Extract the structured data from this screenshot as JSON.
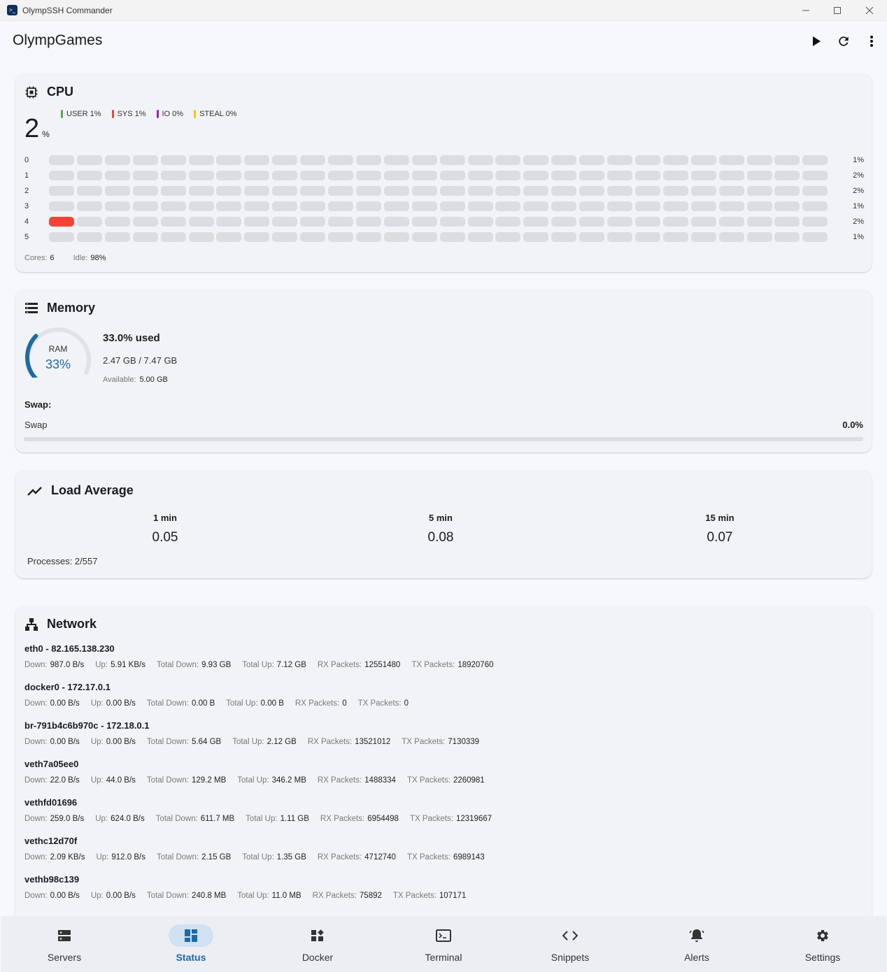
{
  "window": {
    "title": "OlympSSH Commander"
  },
  "header": {
    "host": "OlympGames"
  },
  "cpu": {
    "title": "CPU",
    "total_value": "2",
    "total_unit": "%",
    "legend": [
      {
        "label": "USER 1%",
        "color": "#4caf50"
      },
      {
        "label": "SYS 1%",
        "color": "#f44336"
      },
      {
        "label": "IO 0%",
        "color": "#9c27b0"
      },
      {
        "label": "STEAL 0%",
        "color": "#ffc107"
      }
    ],
    "cores": [
      {
        "id": "0",
        "pct": "1%",
        "lit": 0
      },
      {
        "id": "1",
        "pct": "2%",
        "lit": 0
      },
      {
        "id": "2",
        "pct": "2%",
        "lit": 0
      },
      {
        "id": "3",
        "pct": "1%",
        "lit": 0
      },
      {
        "id": "4",
        "pct": "2%",
        "lit": 1
      },
      {
        "id": "5",
        "pct": "1%",
        "lit": 0
      }
    ],
    "cores_label": "Cores:",
    "cores_value": "6",
    "idle_label": "Idle:",
    "idle_value": "98%"
  },
  "memory": {
    "title": "Memory",
    "gauge_label": "RAM",
    "gauge_value": "33%",
    "gauge_fraction": 0.33,
    "used_text": "33.0% used",
    "amount_text": "2.47 GB / 7.47 GB",
    "available_label": "Available:",
    "available_value": "5.00 GB",
    "swap_heading": "Swap:",
    "swap_label": "Swap",
    "swap_value": "0.0%",
    "swap_fraction": 0
  },
  "load": {
    "title": "Load Average",
    "columns": [
      {
        "label": "1 min",
        "value": "0.05"
      },
      {
        "label": "5 min",
        "value": "0.08"
      },
      {
        "label": "15 min",
        "value": "0.07"
      }
    ],
    "processes": "Processes: 2/557"
  },
  "network": {
    "title": "Network",
    "labels": {
      "down": "Down:",
      "up": "Up:",
      "total_down": "Total Down:",
      "total_up": "Total Up:",
      "rx": "RX Packets:",
      "tx": "TX Packets:"
    },
    "interfaces": [
      {
        "name": "eth0 - 82.165.138.230",
        "down": "987.0 B/s",
        "up": "5.91 KB/s",
        "total_down": "9.93 GB",
        "total_up": "7.12 GB",
        "rx": "12551480",
        "tx": "18920760"
      },
      {
        "name": "docker0 - 172.17.0.1",
        "down": "0.00 B/s",
        "up": "0.00 B/s",
        "total_down": "0.00 B",
        "total_up": "0.00 B",
        "rx": "0",
        "tx": "0"
      },
      {
        "name": "br-791b4c6b970c - 172.18.0.1",
        "down": "0.00 B/s",
        "up": "0.00 B/s",
        "total_down": "5.64 GB",
        "total_up": "2.12 GB",
        "rx": "13521012",
        "tx": "7130339"
      },
      {
        "name": "veth7a05ee0",
        "down": "22.0 B/s",
        "up": "44.0 B/s",
        "total_down": "129.2 MB",
        "total_up": "346.2 MB",
        "rx": "1488334",
        "tx": "2260981"
      },
      {
        "name": "vethfd01696",
        "down": "259.0 B/s",
        "up": "624.0 B/s",
        "total_down": "611.7 MB",
        "total_up": "1.11 GB",
        "rx": "6954498",
        "tx": "12319667"
      },
      {
        "name": "vethc12d70f",
        "down": "2.09 KB/s",
        "up": "912.0 B/s",
        "total_down": "2.15 GB",
        "total_up": "1.35 GB",
        "rx": "4712740",
        "tx": "6989143"
      },
      {
        "name": "vethb98c139",
        "down": "0.00 B/s",
        "up": "0.00 B/s",
        "total_down": "240.8 MB",
        "total_up": "11.0 MB",
        "rx": "75892",
        "tx": "107171"
      }
    ]
  },
  "nav": {
    "active": "Status",
    "items": [
      {
        "label": "Servers",
        "icon": "servers-icon"
      },
      {
        "label": "Status",
        "icon": "dashboard-icon"
      },
      {
        "label": "Docker",
        "icon": "widgets-icon"
      },
      {
        "label": "Terminal",
        "icon": "terminal-icon"
      },
      {
        "label": "Snippets",
        "icon": "code-icon"
      },
      {
        "label": "Alerts",
        "icon": "bell-icon"
      },
      {
        "label": "Settings",
        "icon": "gear-icon"
      }
    ]
  },
  "colors": {
    "accent": "#1e6aa8",
    "active_pill": "#cfe1f3",
    "core_active": "#f44336"
  }
}
